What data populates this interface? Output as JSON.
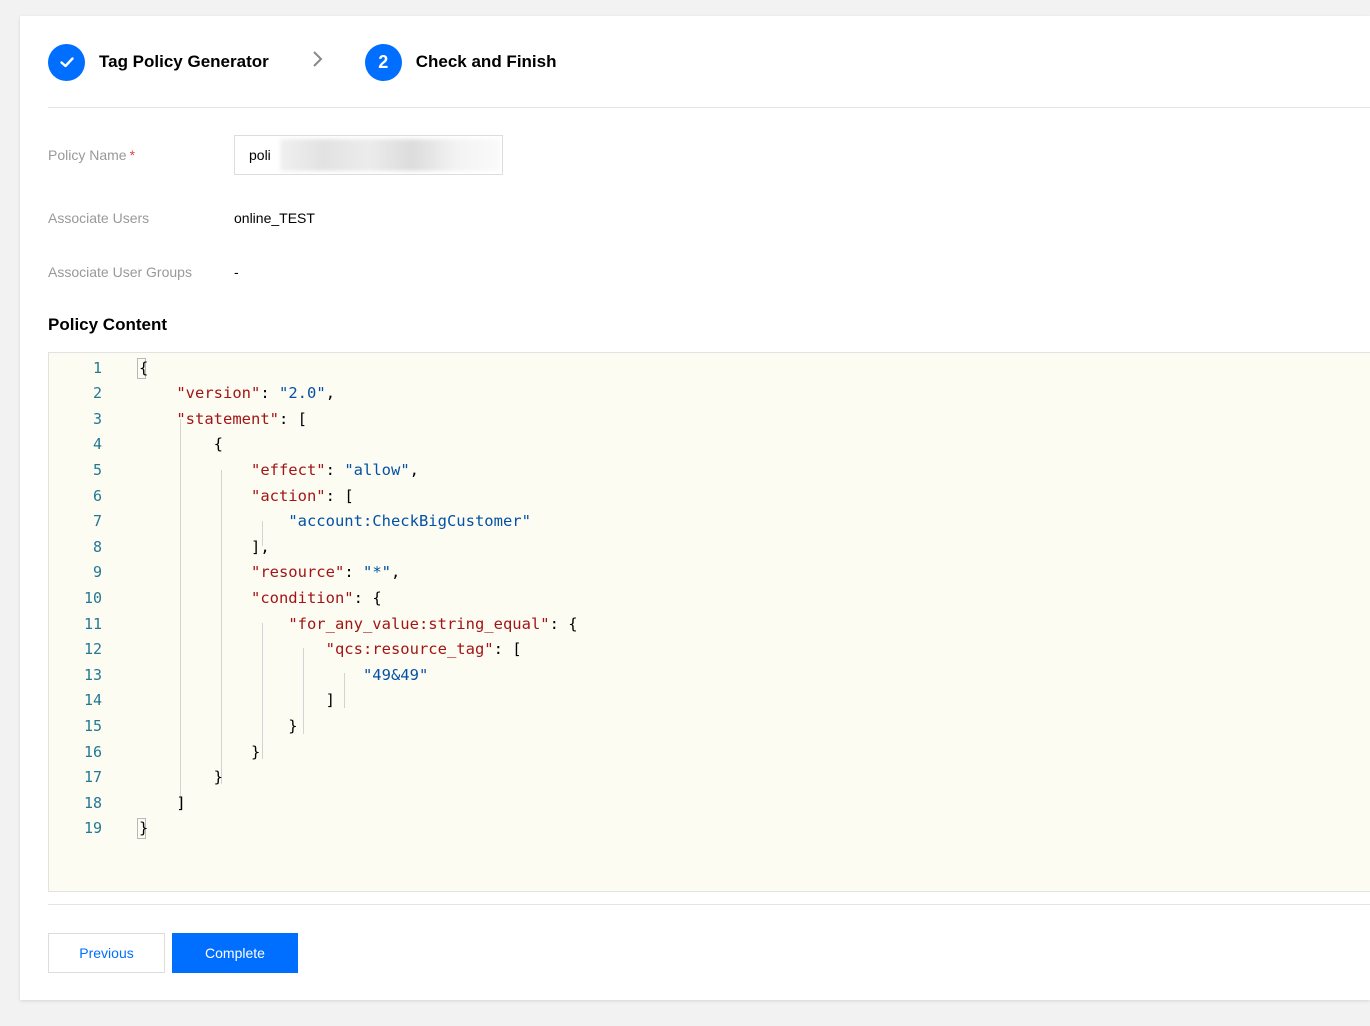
{
  "steps": [
    {
      "index": "",
      "label": "Tag Policy Generator",
      "status": "done",
      "icon": "check-icon"
    },
    {
      "index": "2",
      "label": "Check and Finish",
      "status": "current"
    }
  ],
  "separator_icon": "chevron-right-icon",
  "form": {
    "policy_name_label": "Policy Name",
    "policy_name_required": "*",
    "policy_name_value": "poli",
    "associate_users_label": "Associate Users",
    "associate_users_value": "online_TEST",
    "associate_groups_label": "Associate User Groups",
    "associate_groups_value": "-"
  },
  "policy_content_title": "Policy Content",
  "code_lines": [
    {
      "n": "1",
      "text": "{"
    },
    {
      "n": "2",
      "text": "    \"version\": \"2.0\","
    },
    {
      "n": "3",
      "text": "    \"statement\": ["
    },
    {
      "n": "4",
      "text": "        {"
    },
    {
      "n": "5",
      "text": "            \"effect\": \"allow\","
    },
    {
      "n": "6",
      "text": "            \"action\": ["
    },
    {
      "n": "7",
      "text": "                \"account:CheckBigCustomer\""
    },
    {
      "n": "8",
      "text": "            ],"
    },
    {
      "n": "9",
      "text": "            \"resource\": \"*\","
    },
    {
      "n": "10",
      "text": "            \"condition\": {"
    },
    {
      "n": "11",
      "text": "                \"for_any_value:string_equal\": {"
    },
    {
      "n": "12",
      "text": "                    \"qcs:resource_tag\": ["
    },
    {
      "n": "13",
      "text": "                        \"49&49\""
    },
    {
      "n": "14",
      "text": "                    ]"
    },
    {
      "n": "15",
      "text": "                }"
    },
    {
      "n": "16",
      "text": "            }"
    },
    {
      "n": "17",
      "text": "        }"
    },
    {
      "n": "18",
      "text": "    ]"
    },
    {
      "n": "19",
      "text": "}"
    }
  ],
  "buttons": {
    "previous": "Previous",
    "complete": "Complete"
  },
  "colors": {
    "accent": "#006eff",
    "json_key": "#a31515",
    "json_string": "#0451a5",
    "line_number": "#237893",
    "editor_bg": "#fcfcf3"
  }
}
